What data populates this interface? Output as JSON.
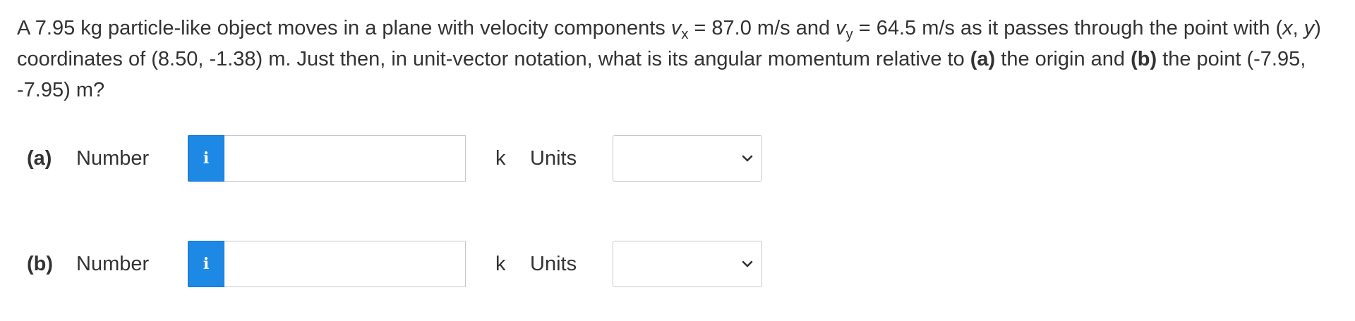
{
  "question": {
    "p1": "A 7.95 kg particle-like object moves in a plane with velocity components ",
    "v": "v",
    "x_sub": "x",
    "p2": " = 87.0 m/s and ",
    "y_sub": "y",
    "p3": " = 64.5 m/s as it passes through the point with (",
    "x_var": "x",
    "comma": ", ",
    "y_var": "y",
    "p4": ") coordinates of (8.50, -1.38) m. Just then, in unit-vector notation, what is its angular momentum relative to ",
    "part_a": "(a)",
    "p5": " the origin and ",
    "part_b": "(b)",
    "p6": " the point (-7.95, -7.95) m?"
  },
  "answers": [
    {
      "part_label": "(a)",
      "number_label": "Number",
      "info_icon": "i",
      "input_value": "",
      "unit_vector": "k",
      "units_label": "Units",
      "units_selected": "",
      "dropdown_icon": "chevron-down-icon"
    },
    {
      "part_label": "(b)",
      "number_label": "Number",
      "info_icon": "i",
      "input_value": "",
      "unit_vector": "k",
      "units_label": "Units",
      "units_selected": "",
      "dropdown_icon": "chevron-down-icon"
    }
  ],
  "colors": {
    "info_button": "#1e88e5",
    "text": "#333333",
    "border": "#c8c8c8"
  }
}
